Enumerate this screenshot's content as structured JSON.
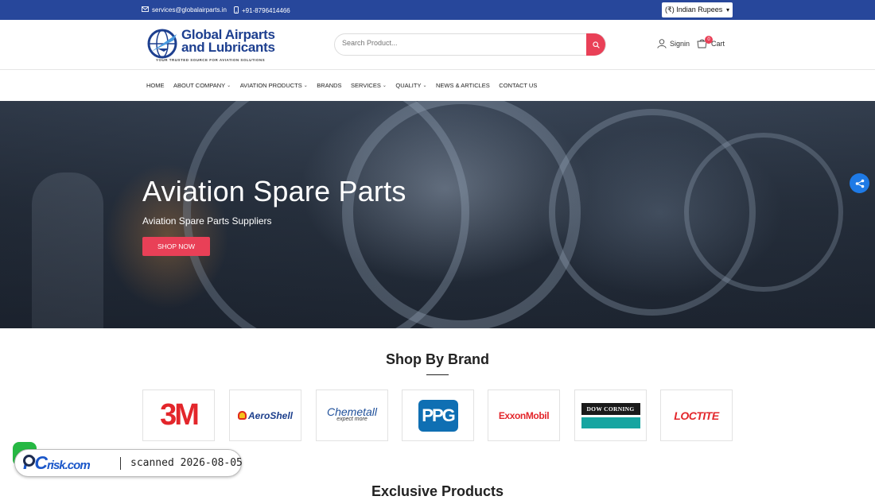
{
  "topbar": {
    "email": "services@globalairparts.in",
    "phone": "+91-8796414466",
    "currency_selected": "(₹)  Indian Rupees"
  },
  "header": {
    "logo_line1": "Global Airparts",
    "logo_line2": "and Lubricants",
    "logo_tagline": "YOUR TRUSTED SOURCE FOR AVIATION SOLUTIONS",
    "search_placeholder": "Search Product...",
    "signin_label": "Signin",
    "cart_label": "Cart",
    "cart_count": "0"
  },
  "nav": {
    "items": [
      {
        "label": "HOME",
        "dropdown": false
      },
      {
        "label": "ABOUT COMPANY",
        "dropdown": true
      },
      {
        "label": "AVIATION PRODUCTS",
        "dropdown": true
      },
      {
        "label": "BRANDS",
        "dropdown": false
      },
      {
        "label": "SERVICES",
        "dropdown": true
      },
      {
        "label": "QUALITY",
        "dropdown": true
      },
      {
        "label": "NEWS & ARTICLES",
        "dropdown": false
      },
      {
        "label": "CONTACT US",
        "dropdown": false
      }
    ]
  },
  "hero": {
    "title": "Aviation Spare Parts",
    "subtitle": "Aviation Spare Parts Suppliers",
    "button": "SHOP NOW"
  },
  "brands_section": {
    "title": "Shop By Brand",
    "brands": [
      {
        "name": "3M"
      },
      {
        "name": "AeroShell"
      },
      {
        "name": "Chemetall",
        "tagline": "expect more"
      },
      {
        "name": "PPG"
      },
      {
        "name": "ExxonMobil"
      },
      {
        "name": "DOW CORNING"
      },
      {
        "name": "LOCTITE"
      }
    ]
  },
  "next_section_title": "Exclusive Products",
  "overlay": {
    "pc_mark": "PC",
    "risk_mark": "risk.com",
    "scanned_text": "scanned 2026-08-05"
  },
  "colors": {
    "topbar": "#27479b",
    "accent": "#e94057",
    "brand_blue": "#1d3f8f"
  }
}
